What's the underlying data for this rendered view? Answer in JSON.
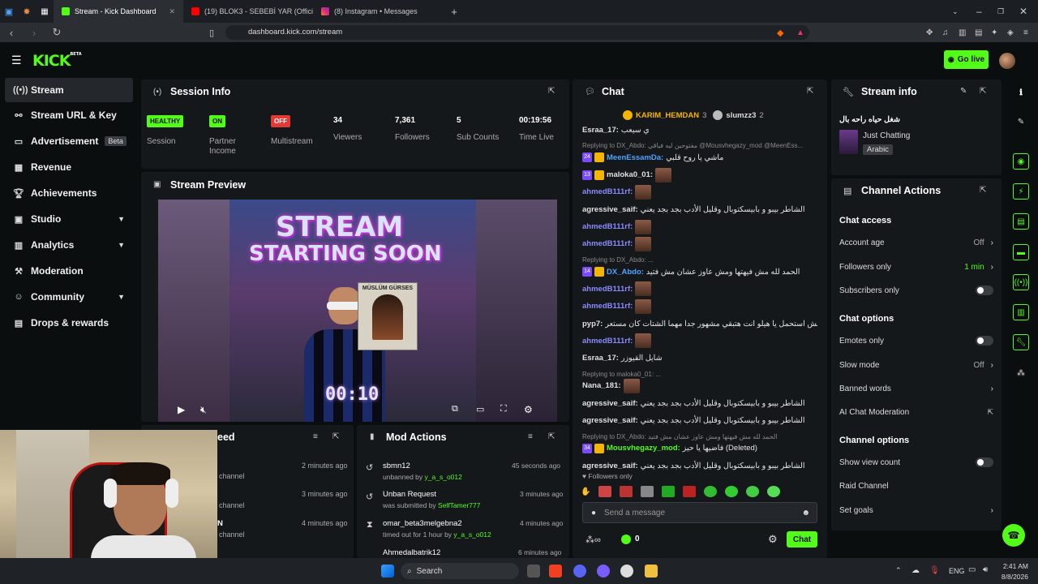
{
  "browser": {
    "tabs": [
      {
        "title": "Stream - Kick Dashboard",
        "active": true
      },
      {
        "title": "(19) BLOK3 - SEBEBİ YAR (Official Mu",
        "active": false
      },
      {
        "title": "(8) Instagram • Messages",
        "active": false
      }
    ],
    "url": "dashboard.kick.com/stream"
  },
  "header": {
    "logo": "KICK",
    "logo_badge": "BETA",
    "go_live_label": "Go live"
  },
  "sidebar": {
    "items": [
      {
        "label": "Stream",
        "icon": "broadcast-icon"
      },
      {
        "label": "Stream URL & Key",
        "icon": "link-icon"
      },
      {
        "label": "Advertisement",
        "icon": "ad-icon",
        "badge": "Beta"
      },
      {
        "label": "Revenue",
        "icon": "revenue-icon"
      },
      {
        "label": "Achievements",
        "icon": "trophy-icon"
      },
      {
        "label": "Studio",
        "icon": "studio-icon"
      },
      {
        "label": "Analytics",
        "icon": "chart-icon"
      },
      {
        "label": "Moderation",
        "icon": "hammer-icon"
      },
      {
        "label": "Community",
        "icon": "community-icon"
      },
      {
        "label": "Drops & rewards",
        "icon": "gift-icon"
      }
    ]
  },
  "session_info": {
    "title": "Session Info",
    "stats": [
      {
        "badge": "HEALTHY",
        "label": "Session"
      },
      {
        "badge": "ON",
        "label": "Partner Income"
      },
      {
        "badge": "OFF",
        "label": "Multistream"
      },
      {
        "value": "34",
        "label": "Viewers"
      },
      {
        "value": "7,361",
        "label": "Followers"
      },
      {
        "value": "5",
        "label": "Sub Counts"
      },
      {
        "value": "00:19:56",
        "label": "Time Live"
      }
    ]
  },
  "stream_preview": {
    "title": "Stream Preview",
    "overlay_line1": "STREAM",
    "overlay_line2": "STARTING SOON",
    "poster_text": "MÜSLÜM GÜRSES",
    "countdown": "00:10"
  },
  "activity_feed": {
    "title_partial": "eed",
    "rows": [
      {
        "text": "channel",
        "time": "2 minutes ago"
      },
      {
        "text": "channel",
        "time": "3 minutes ago"
      },
      {
        "text": "channel",
        "time": "4 minutes ago"
      }
    ],
    "row3_prefix": "N"
  },
  "mod_actions": {
    "title": "Mod Actions",
    "rows": [
      {
        "title": "sbmn12",
        "sub_pre": "unbanned by ",
        "sub_user": "y_a_s_o012",
        "time": "45 seconds ago"
      },
      {
        "title": "Unban Request",
        "sub_pre": "was submitted by ",
        "sub_user": "SelfTamer777",
        "time": "3 minutes ago"
      },
      {
        "title": "omar_beta3melgebna2",
        "sub_pre": "timed out for 1 hour by ",
        "sub_user": "y_a_s_o012",
        "time": "4 minutes ago"
      },
      {
        "title": "Ahmedalbatrik12",
        "sub_pre": "",
        "sub_user": "",
        "time": "6 minutes ago"
      }
    ]
  },
  "chat": {
    "title": "Chat",
    "top_gifters": [
      {
        "name": "KARIM_HEMDAN",
        "count": "3"
      },
      {
        "name": "slumzz3",
        "count": "2"
      }
    ],
    "lines": [
      {
        "user": "Esraa_17:",
        "color": "#e0e0e0",
        "msg": "ي سيعب"
      },
      {
        "reply": "Replying to DX_Abdo: مفتوحين ليه فياقي @Mousvhegazy_mod @MeenEss..."
      },
      {
        "user": "MeenEssamDa:",
        "color": "#4fa3ff",
        "msg": "ماشي يا روح قلبي",
        "badge": "24"
      },
      {
        "user": "maloka0_01:",
        "color": "#e0e0e0",
        "msg": "",
        "badge": "13"
      },
      {
        "user": "ahmedB111rf:",
        "color": "#8a8aff",
        "msg": ""
      },
      {
        "user": "agressive_saif:",
        "color": "#e0e0e0",
        "msg": "الشاطر بيبو و بابيسكتوبال وقليل الأدب بجد بجد يعني"
      },
      {
        "user": "ahmedB111rf:",
        "color": "#8a8aff",
        "msg": ""
      },
      {
        "user": "ahmedB111rf:",
        "color": "#8a8aff",
        "msg": ""
      },
      {
        "reply": "Replying to DX_Abdo: ..."
      },
      {
        "user": "DX_Abdo:",
        "color": "#4fa3ff",
        "msg": "الحمد لله مش فيهتها ومش عاوز عشان مش فتيد",
        "badge": "14"
      },
      {
        "user": "ahmedB111rf:",
        "color": "#8a8aff",
        "msg": ""
      },
      {
        "user": "ahmedB111rf:",
        "color": "#8a8aff",
        "msg": ""
      },
      {
        "user": "pyp7:",
        "color": "#e0e0e0",
        "msg": "مايلش استحمل يا هيلو انت هتبقي مشهور جدا مهما الشتات كان مستعر"
      },
      {
        "user": "ahmedB111rf:",
        "color": "#8a8aff",
        "msg": ""
      },
      {
        "user": "Esraa_17:",
        "color": "#e0e0e0",
        "msg": "شايل القيوزر"
      },
      {
        "reply": "Replying to maloka0_01: ..."
      },
      {
        "user": "Nana_181:",
        "color": "#e0e0e0",
        "msg": ""
      },
      {
        "user": "agressive_saif:",
        "color": "#e0e0e0",
        "msg": "الشاطر بيبو و بابيسكتوبال وقليل الأدب بجد بجد يعني"
      },
      {
        "user": "agressive_saif:",
        "color": "#e0e0e0",
        "msg": "الشاطر بيبو و بابيسكتوبال وقليل الأدب بجد بجد يعني"
      },
      {
        "reply": "Replying to DX_Abdo: الحمد لله مش فيهتها ومش عاوز عشان مش فتيد"
      },
      {
        "user": "Mousvhegazy_mod:",
        "color": "#53fc18",
        "msg": "فاضيها يا حيز (Deleted)",
        "badge": "34"
      },
      {
        "user": "agressive_saif:",
        "color": "#e0e0e0",
        "msg": "الشاطر بيبو و بابيسكتوبال وقليل الأدب بجد بجد يعني"
      }
    ],
    "followers_only_label": "Followers only",
    "input_placeholder": "Send a message",
    "viewers_count": "0",
    "send_label": "Chat"
  },
  "stream_info": {
    "title": "Stream info",
    "stream_title": "شغل حياه راحه بال",
    "category": "Just Chatting",
    "language": "Arabic"
  },
  "channel_actions": {
    "title": "Channel Actions",
    "chat_access_heading": "Chat access",
    "account_age": {
      "label": "Account age",
      "value": "Off"
    },
    "followers_only": {
      "label": "Followers only",
      "value": "1 min"
    },
    "subscribers_only": {
      "label": "Subscribers only"
    },
    "chat_options_heading": "Chat options",
    "emotes_only": {
      "label": "Emotes only"
    },
    "slow_mode": {
      "label": "Slow mode",
      "value": "Off"
    },
    "banned_words": {
      "label": "Banned words"
    },
    "ai_moderation": {
      "label": "AI Chat Moderation"
    },
    "channel_options_heading": "Channel options",
    "show_view_count": {
      "label": "Show view count"
    },
    "raid_channel": {
      "label": "Raid Channel"
    },
    "set_goals": {
      "label": "Set goals"
    }
  },
  "taskbar": {
    "search_label": "Search",
    "lang": "ENG",
    "time": "2:41 AM",
    "date": "8/8/2026"
  },
  "colors": {
    "accent": "#53fc18",
    "healthy": "#53fc18",
    "off": "#e53935",
    "panel": "#15181b",
    "bg": "#0b0e0f"
  }
}
